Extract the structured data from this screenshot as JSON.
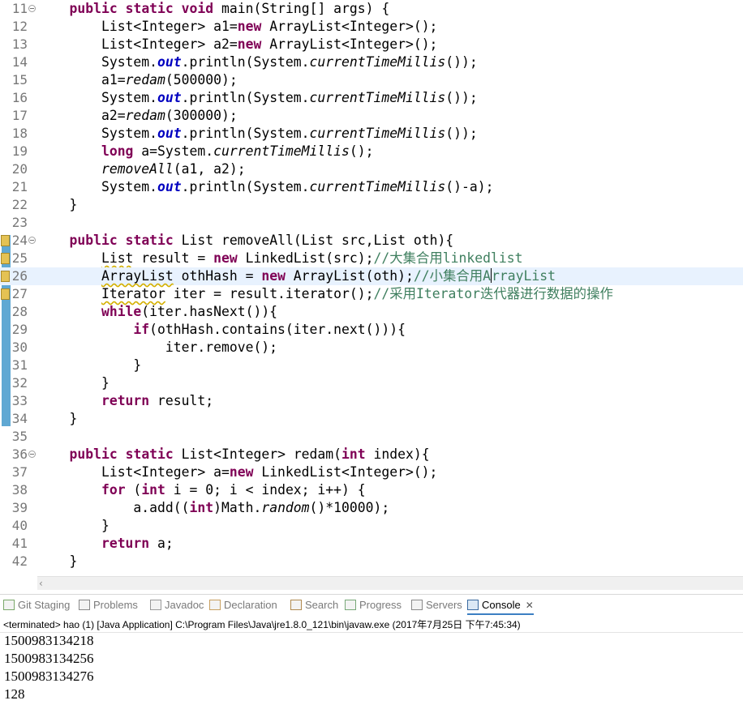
{
  "editor": {
    "lines": [
      {
        "no": "11",
        "fold": true
      },
      {
        "no": "12"
      },
      {
        "no": "13"
      },
      {
        "no": "14"
      },
      {
        "no": "15"
      },
      {
        "no": "16"
      },
      {
        "no": "17"
      },
      {
        "no": "18"
      },
      {
        "no": "19"
      },
      {
        "no": "20"
      },
      {
        "no": "21"
      },
      {
        "no": "22"
      },
      {
        "no": "23"
      },
      {
        "no": "24",
        "fold": true,
        "marker": true
      },
      {
        "no": "25",
        "marker": true
      },
      {
        "no": "26",
        "marker": true,
        "current": true
      },
      {
        "no": "27",
        "marker": true
      },
      {
        "no": "28"
      },
      {
        "no": "29"
      },
      {
        "no": "30"
      },
      {
        "no": "31"
      },
      {
        "no": "32"
      },
      {
        "no": "33"
      },
      {
        "no": "34"
      },
      {
        "no": "35"
      },
      {
        "no": "36",
        "fold": true
      },
      {
        "no": "37"
      },
      {
        "no": "38"
      },
      {
        "no": "39"
      },
      {
        "no": "40"
      },
      {
        "no": "41"
      },
      {
        "no": "42"
      }
    ],
    "code": {
      "l11": [
        "public",
        "static",
        "void",
        " main(String[] args) {"
      ],
      "l12": "List<Integer> a1=",
      "l12b": "new",
      "l12c": " ArrayList<Integer>();",
      "l13": "List<Integer> a2=",
      "l13c": " ArrayList<Integer>();",
      "sys": "System.",
      "out": "out",
      "println": ".println(System.",
      "ctm": "currentTimeMillis",
      "end1": "());",
      "l15a": "a1=",
      "redam": "redam",
      "l15b": "(500000);",
      "l17a": "a2=",
      "l17b": "(300000);",
      "long": "long",
      "l19a": " a=System.",
      "l19b": "();",
      "removeAll": "removeAll",
      "l20b": "(a1, a2);",
      "l21b": "()-a);",
      "closeBrace": "}",
      "public": "public",
      "static": "static",
      "l24a": " List removeAll(List src,List oth){",
      "l25a": "List",
      "l25b": " result = ",
      "l25c": " LinkedList(src);",
      "l25cm": "//大集合用linkedlist",
      "l26a": "ArrayList",
      "l26b": " othHash = ",
      "l26c": " ArrayList(oth);",
      "l26cm1": "//小集合用A",
      "l26cm2": "rrayList",
      "l27a": "Iterator",
      "l27b": " iter = result.iterator();",
      "l27cm": "//采用Iterator迭代器进行数据的操作",
      "while": "while",
      "l28b": "(iter.hasNext()){",
      "if": "if",
      "l29b": "(othHash.contains(iter.next())){",
      "l30": "iter.remove();",
      "return": "return",
      "l33b": " result;",
      "l36a": " List<Integer> redam(",
      "int": "int",
      "l36b": " index){",
      "l37a": "List<Integer> a=",
      "l37c": " LinkedList<Integer>();",
      "for": "for",
      "l38b": " (",
      "l38c": " i = 0; i < index; i++) {",
      "l39a": "a.add((",
      "l39b": ")Math.",
      "random": "random",
      "l39c": "()*10000);",
      "l41b": " a;"
    }
  },
  "tabs": [
    {
      "label": "Git Staging",
      "icon": "git-staging-icon"
    },
    {
      "label": "Problems",
      "icon": "problems-icon"
    },
    {
      "label": "Javadoc",
      "icon": "javadoc-icon"
    },
    {
      "label": "Declaration",
      "icon": "declaration-icon"
    },
    {
      "label": "Search",
      "icon": "search-icon"
    },
    {
      "label": "Progress",
      "icon": "progress-icon"
    },
    {
      "label": "Servers",
      "icon": "servers-icon"
    },
    {
      "label": "Console",
      "icon": "console-icon",
      "active": true,
      "close": "✕"
    }
  ],
  "console": {
    "status": "<terminated> hao (1) [Java Application] C:\\Program Files\\Java\\jre1.8.0_121\\bin\\javaw.exe (2017年7月25日 下午7:45:34)",
    "output": [
      "1500983134218",
      "1500983134256",
      "1500983134276",
      "128"
    ]
  },
  "colors": {
    "keyword": "#7f0055",
    "static_field": "#0000c0",
    "comment": "#3f7f5f",
    "current_line": "#e8f2fe",
    "active_tab": "#3c7fc2"
  }
}
